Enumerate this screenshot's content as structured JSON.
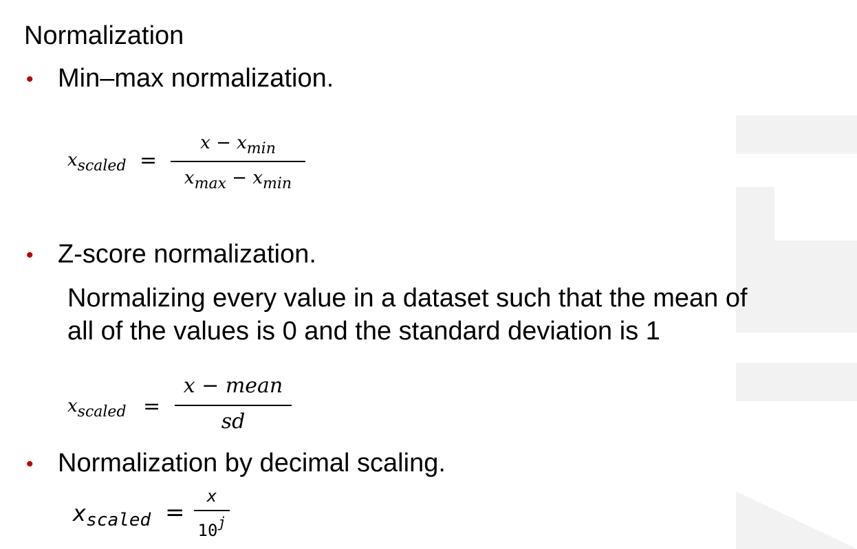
{
  "slide": {
    "title": "Normalization",
    "bullet_color": "#c00000",
    "bullet_glyph": "•"
  },
  "section1": {
    "heading": "Min–max normalization.",
    "lhs_var": "x",
    "lhs_sub": "scaled",
    "equals": "=",
    "num_x": "x",
    "num_minus": "−",
    "num_var": "x",
    "num_sub": "min",
    "den_var1": "x",
    "den_sub1": "max",
    "den_minus": "−",
    "den_var2": "x",
    "den_sub2": "min"
  },
  "section2": {
    "heading": "Z-score normalization.",
    "description_line1": "Normalizing every value in a dataset such that the mean of",
    "description_line2": "all of the values is 0 and the standard deviation is 1",
    "lhs_var": "x",
    "lhs_sub": "scaled",
    "equals": "=",
    "numerator": "x − mean",
    "denominator": "sd"
  },
  "section3": {
    "heading": "Normalization by decimal scaling.",
    "lhs_var": "x",
    "lhs_sub": "scaled",
    "equals": "=",
    "numerator": "x",
    "den_base": "10",
    "den_exp": "j"
  }
}
